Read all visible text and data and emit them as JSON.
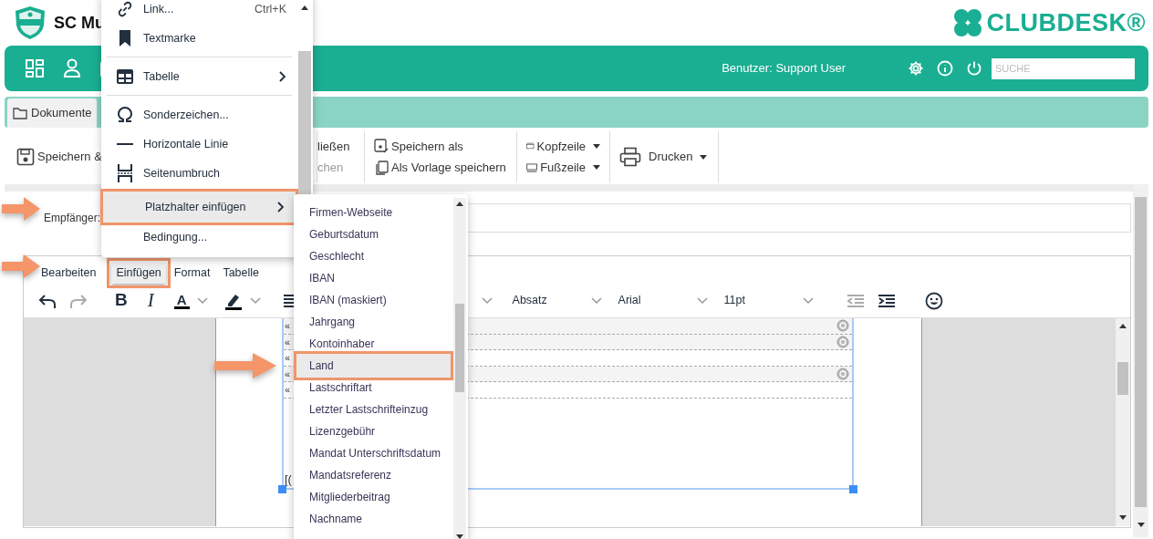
{
  "app": {
    "club_name": "SC Mu",
    "brand": "CLUBDESK®"
  },
  "navbar": {
    "user_label": "Benutzer: Support User",
    "search": {
      "placeholder": "SUCHE"
    }
  },
  "tabs": [
    {
      "label": "Dokumente",
      "selected": true
    }
  ],
  "toolbar": {
    "groups": [
      [
        {
          "label": "Speichern &",
          "disabled": false,
          "dropdown": false
        }
      ],
      [
        {
          "label": "ließen",
          "disabled": false,
          "dropdown": false
        },
        {
          "label": "chen",
          "disabled": true,
          "dropdown": false
        }
      ],
      [
        {
          "label": "Speichern als",
          "disabled": false,
          "dropdown": false
        },
        {
          "label": "Als Vorlage speichern",
          "disabled": false,
          "dropdown": false
        }
      ],
      [
        {
          "label": "Kopfzeile",
          "disabled": false,
          "dropdown": true
        },
        {
          "label": "Fußzeile",
          "disabled": false,
          "dropdown": true
        }
      ],
      [
        {
          "label": "Drucken",
          "disabled": false,
          "dropdown": true
        }
      ]
    ]
  },
  "form": {
    "recipient_label": "Empfänger:"
  },
  "editor": {
    "menubar": [
      {
        "label": "Bearbeiten",
        "selected": false
      },
      {
        "label": "Einfügen",
        "selected": true
      },
      {
        "label": "Format",
        "selected": false
      },
      {
        "label": "Tabelle",
        "selected": false
      }
    ],
    "toolbar": {
      "undo_disabled": false,
      "redo_disabled": true,
      "bold_glyph": "B",
      "italic_glyph": "I",
      "text_color_glyph": "A",
      "block_format": "Absatz",
      "font_family": "Arial",
      "font_size": "11pt",
      "outdent_disabled": true
    },
    "document": {
      "rows": [
        {
          "text": "«",
          "help": true
        },
        {
          "text": "«",
          "help": true
        },
        {
          "text": "«",
          "help": false
        },
        {
          "text": "«",
          "help": true
        },
        {
          "text": "«",
          "help": false
        }
      ],
      "footer_text": "[("
    }
  },
  "insert_menu": {
    "items": [
      {
        "kind": "item",
        "label": "Link...",
        "shortcut": "Ctrl+K",
        "submenu": false,
        "selected": false
      },
      {
        "kind": "item",
        "label": "Textmarke",
        "submenu": false,
        "selected": false
      },
      {
        "kind": "separator"
      },
      {
        "kind": "item",
        "label": "Tabelle",
        "submenu": true,
        "selected": false
      },
      {
        "kind": "separator"
      },
      {
        "kind": "item",
        "label": "Sonderzeichen...",
        "submenu": false,
        "selected": false
      },
      {
        "kind": "item",
        "label": "Horizontale Linie",
        "submenu": false,
        "selected": false
      },
      {
        "kind": "item",
        "label": "Seitenumbruch",
        "submenu": false,
        "selected": false
      },
      {
        "kind": "item",
        "label": "Platzhalter einfügen",
        "submenu": true,
        "selected": true
      },
      {
        "kind": "item",
        "label": "Bedingung...",
        "submenu": false,
        "selected": false
      }
    ]
  },
  "placeholder_menu": {
    "items": [
      {
        "label": "Firmen-Webseite",
        "selected": false
      },
      {
        "label": "Geburtsdatum",
        "selected": false
      },
      {
        "label": "Geschlecht",
        "selected": false
      },
      {
        "label": "IBAN",
        "selected": false
      },
      {
        "label": "IBAN (maskiert)",
        "selected": false
      },
      {
        "label": "Jahrgang",
        "selected": false
      },
      {
        "label": "Kontoinhaber",
        "selected": false
      },
      {
        "label": "Land",
        "selected": true
      },
      {
        "label": "Lastschriftart",
        "selected": false
      },
      {
        "label": "Letzter Lastschrifteinzug",
        "selected": false
      },
      {
        "label": "Lizenzgebühr",
        "selected": false
      },
      {
        "label": "Mandat Unterschriftsdatum",
        "selected": false
      },
      {
        "label": "Mandatsreferenz",
        "selected": false
      },
      {
        "label": "Mitgliederbeitrag",
        "selected": false
      },
      {
        "label": "Nachname",
        "selected": false
      }
    ]
  }
}
